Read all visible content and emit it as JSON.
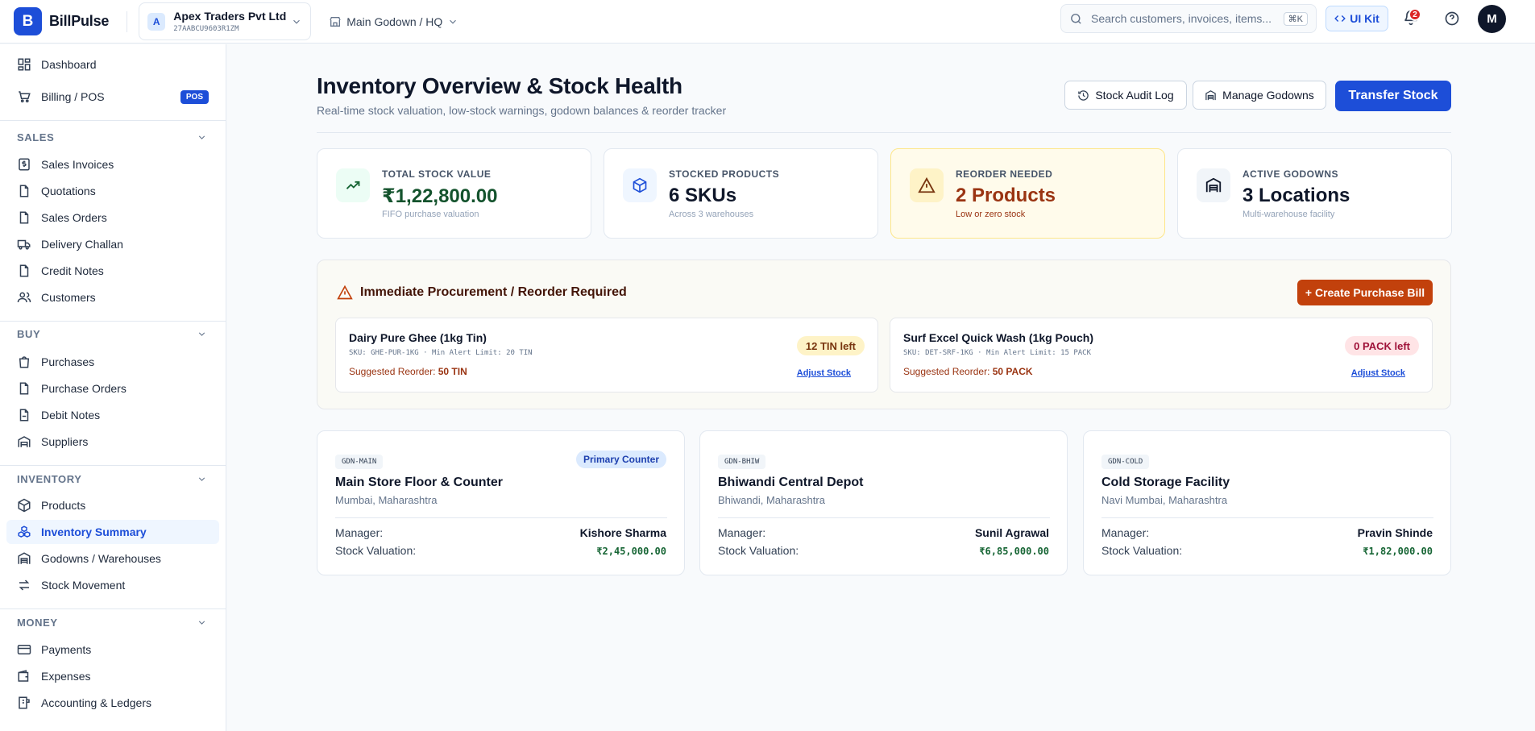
{
  "brand": {
    "logo_letter": "B",
    "name": "BillPulse"
  },
  "org": {
    "initial": "A",
    "name": "Apex Traders Pvt Ltd",
    "gstin": "27AABCU9603R1ZM"
  },
  "godown_switch": {
    "label": "Main Godown / HQ"
  },
  "search": {
    "placeholder": "Search customers, invoices, items...",
    "shortcut": "⌘K"
  },
  "header_actions": {
    "ui_kit": "UI Kit",
    "notifications": "2",
    "user_initial": "M"
  },
  "sidebar": {
    "top": [
      {
        "label": "Dashboard",
        "icon": "dashboard-icon"
      },
      {
        "label": "Billing / POS",
        "icon": "cart-icon",
        "badge": "POS"
      }
    ],
    "sections": [
      {
        "title": "SALES",
        "items": [
          "Sales Invoices",
          "Quotations",
          "Sales Orders",
          "Delivery Challan",
          "Credit Notes",
          "Customers"
        ]
      },
      {
        "title": "BUY",
        "items": [
          "Purchases",
          "Purchase Orders",
          "Debit Notes",
          "Suppliers"
        ]
      },
      {
        "title": "INVENTORY",
        "items": [
          "Products",
          "Inventory Summary",
          "Godowns / Warehouses",
          "Stock Movement"
        ],
        "active": "Inventory Summary"
      },
      {
        "title": "MONEY",
        "items": [
          "Payments",
          "Expenses",
          "Accounting & Ledgers"
        ]
      }
    ]
  },
  "page": {
    "title": "Inventory Overview & Stock Health",
    "subtitle": "Real-time stock valuation, low-stock warnings, godown balances & reorder tracker",
    "buttons": {
      "audit": "Stock Audit Log",
      "godowns": "Manage Godowns",
      "transfer": "Transfer Stock"
    }
  },
  "stats": [
    {
      "label": "TOTAL STOCK VALUE",
      "value": "₹1,22,800.00",
      "note": "FIFO purchase valuation",
      "icon": "trend-up-icon",
      "color": "#166534"
    },
    {
      "label": "STOCKED PRODUCTS",
      "value": "6 SKUs",
      "note": "Across 3 warehouses",
      "icon": "box-icon",
      "color": "#0f172a"
    },
    {
      "label": "REORDER NEEDED",
      "value": "2 Products",
      "note": "Low or zero stock",
      "icon": "warning-icon",
      "color": "#9a3412"
    },
    {
      "label": "ACTIVE GODOWNS",
      "value": "3 Locations",
      "note": "Multi-warehouse facility",
      "icon": "warehouse-icon",
      "color": "#0f172a"
    }
  ],
  "reorder": {
    "title": "Immediate Procurement / Reorder Required",
    "create_button": "+ Create Purchase Bill",
    "items": [
      {
        "name": "Dairy Pure Ghee (1kg Tin)",
        "meta": "SKU: GHE-PUR-1KG · Min Alert Limit: 20 TIN",
        "suggest_label": "Suggested Reorder:",
        "suggest_value": "50 TIN",
        "stock": "12 TIN left",
        "action": "Adjust Stock"
      },
      {
        "name": "Surf Excel Quick Wash (1kg Pouch)",
        "meta": "SKU: DET-SRF-1KG · Min Alert Limit: 15 PACK",
        "suggest_label": "Suggested Reorder:",
        "suggest_value": "50 PACK",
        "stock": "0 PACK left",
        "action": "Adjust Stock"
      }
    ]
  },
  "godowns": [
    {
      "code": "GDN-MAIN",
      "tag": "Primary Counter",
      "name": "Main Store Floor & Counter",
      "location": "Mumbai, Maharashtra",
      "manager_label": "Manager:",
      "manager": "Kishore Sharma",
      "valuation_label": "Stock Valuation:",
      "valuation": "₹2,45,000.00"
    },
    {
      "code": "GDN-BHIW",
      "tag": "",
      "name": "Bhiwandi Central Depot",
      "location": "Bhiwandi, Maharashtra",
      "manager_label": "Manager:",
      "manager": "Sunil Agrawal",
      "valuation_label": "Stock Valuation:",
      "valuation": "₹6,85,000.00"
    },
    {
      "code": "GDN-COLD",
      "tag": "",
      "name": "Cold Storage Facility",
      "location": "Navi Mumbai, Maharashtra",
      "manager_label": "Manager:",
      "manager": "Pravin Shinde",
      "valuation_label": "Stock Valuation:",
      "valuation": "₹1,82,000.00"
    }
  ]
}
